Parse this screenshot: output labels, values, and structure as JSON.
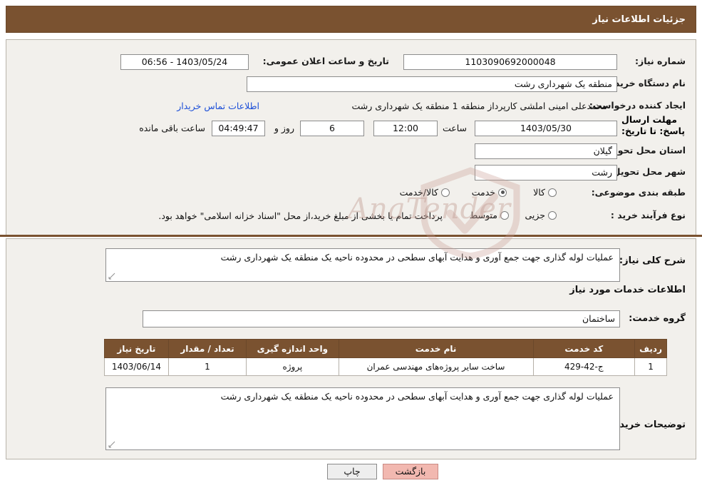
{
  "header": {
    "title": "جزئیات اطلاعات نیاز"
  },
  "form": {
    "need_number_label": "شماره نیاز:",
    "need_number_value": "1103090692000048",
    "public_announce_label": "تاریخ و ساعت اعلان عمومی:",
    "public_announce_value": "1403/05/24 - 06:56",
    "buyer_org_label": "نام دستگاه خریدار:",
    "buyer_org_value": "منطقه یک شهرداری رشت",
    "creator_label": "ایجاد کننده درخواست:",
    "creator_value": "محمدعلی امینی املشی کارپرداز منطقه 1 منطقه یک شهرداری رشت",
    "contact_link": "اطلاعات تماس خریدار",
    "deadline_label": "مهلت ارسال پاسخ: تا تاریخ:",
    "deadline_date": "1403/05/30",
    "hour_label": "ساعت",
    "hour_value": "12:00",
    "days_value": "6",
    "days_label": "روز و",
    "remaining_value": "04:49:47",
    "remaining_label": "ساعت باقی مانده",
    "province_label": "استان محل تحویل:",
    "province_value": "گیلان",
    "city_label": "شهر محل تحویل:",
    "city_value": "رشت",
    "category_label": "طبقه بندی موضوعی:",
    "category_options": [
      "کالا",
      "خدمت",
      "کالا/خدمت"
    ],
    "category_selected": "خدمت",
    "purchase_type_label": "نوع فرآیند خرید :",
    "purchase_options": [
      "جزیی",
      "متوسط"
    ],
    "purchase_selected": "",
    "purchase_note": "پرداخت تمام یا بخشی از مبلغ خرید،از محل \"اسناد خزانه اسلامی\" خواهد بود."
  },
  "details": {
    "general_desc_label": "شرح کلی نیاز:",
    "general_desc_value": "عملیات لوله گذاری جهت جمع آوری و هدایت آبهای سطحی در محدوده ناحیه یک منطقه یک شهرداری رشت",
    "services_section_title": "اطلاعات خدمات مورد نیاز",
    "service_group_label": "گروه خدمت:",
    "service_group_value": "ساختمان",
    "buyer_notes_label": "توضیحات خریدار:",
    "buyer_notes_value": "عملیات لوله گذاری جهت جمع آوری و هدایت آبهای سطحی در محدوده ناحیه یک منطقه یک شهرداری رشت"
  },
  "table": {
    "headers": [
      "ردیف",
      "کد خدمت",
      "نام خدمت",
      "واحد اندازه گیری",
      "تعداد / مقدار",
      "تاریخ نیاز"
    ],
    "rows": [
      [
        "1",
        "ج-42-429",
        "ساخت سایر پروژه‌های مهندسی عمران",
        "پروژه",
        "1",
        "1403/06/14"
      ]
    ]
  },
  "footer": {
    "print_label": "چاپ",
    "back_label": "بازگشت"
  },
  "watermark": {
    "text": "AnaTender"
  },
  "colors": {
    "brand": "#7a5230",
    "link": "#1c4fd8",
    "panel": "#f2f0ec",
    "back_button": "#f2b8b0"
  }
}
